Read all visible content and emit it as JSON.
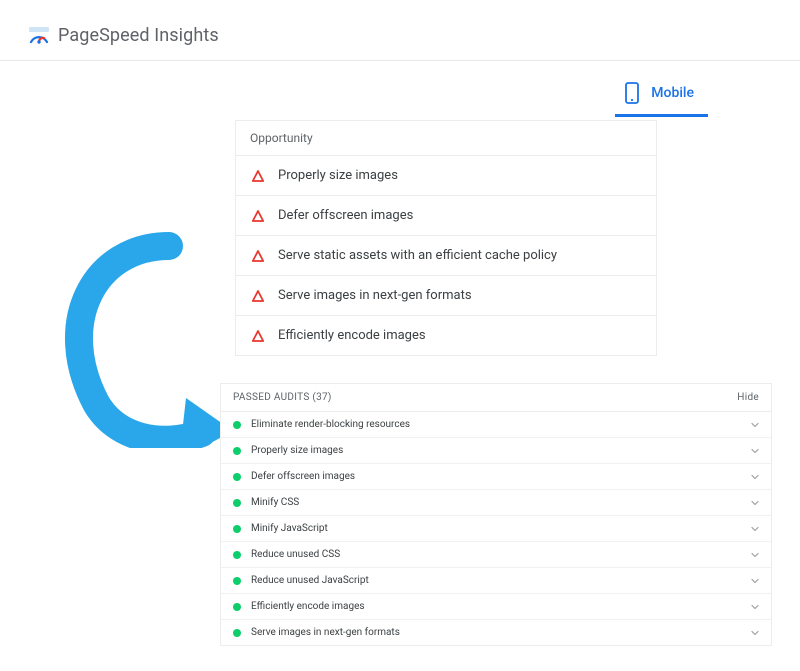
{
  "header": {
    "title": "PageSpeed Insights"
  },
  "tab": {
    "label": "Mobile"
  },
  "opportunity": {
    "header": "Opportunity",
    "items": [
      "Properly size images",
      "Defer offscreen images",
      "Serve static assets with an efficient cache policy",
      "Serve images in next-gen formats",
      "Efficiently encode images"
    ]
  },
  "passed": {
    "header_label": "PASSED AUDITS",
    "count_label": "(37)",
    "hide_label": "Hide",
    "items": [
      "Eliminate render-blocking resources",
      "Properly size images",
      "Defer offscreen images",
      "Minify CSS",
      "Minify JavaScript",
      "Reduce unused CSS",
      "Reduce unused JavaScript",
      "Efficiently encode images",
      "Serve images in next-gen formats"
    ]
  },
  "colors": {
    "accent": "#1a73e8",
    "warn": "#e8382f",
    "pass": "#0cce6b",
    "arrow": "#2aa7ea"
  }
}
